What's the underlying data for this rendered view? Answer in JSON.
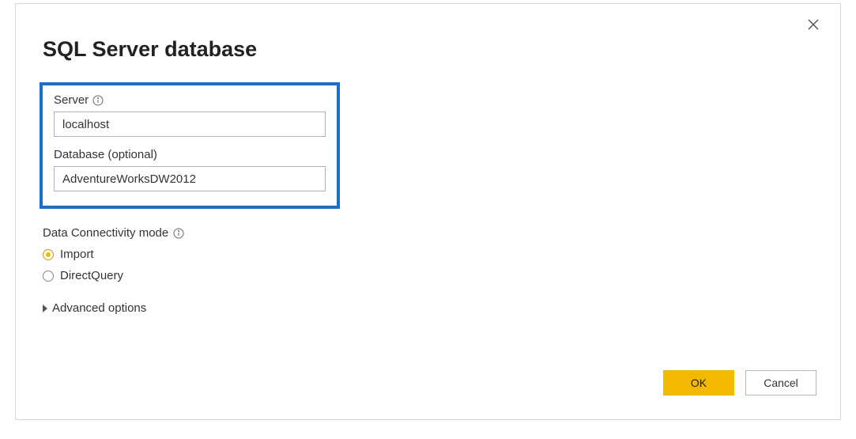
{
  "dialog": {
    "title": "SQL Server database"
  },
  "fields": {
    "server": {
      "label": "Server",
      "value": "localhost"
    },
    "database": {
      "label": "Database (optional)",
      "value": "AdventureWorksDW2012"
    }
  },
  "connectivity": {
    "label": "Data Connectivity mode",
    "options": {
      "import": "Import",
      "directquery": "DirectQuery"
    }
  },
  "advanced": {
    "label": "Advanced options"
  },
  "buttons": {
    "ok": "OK",
    "cancel": "Cancel"
  }
}
